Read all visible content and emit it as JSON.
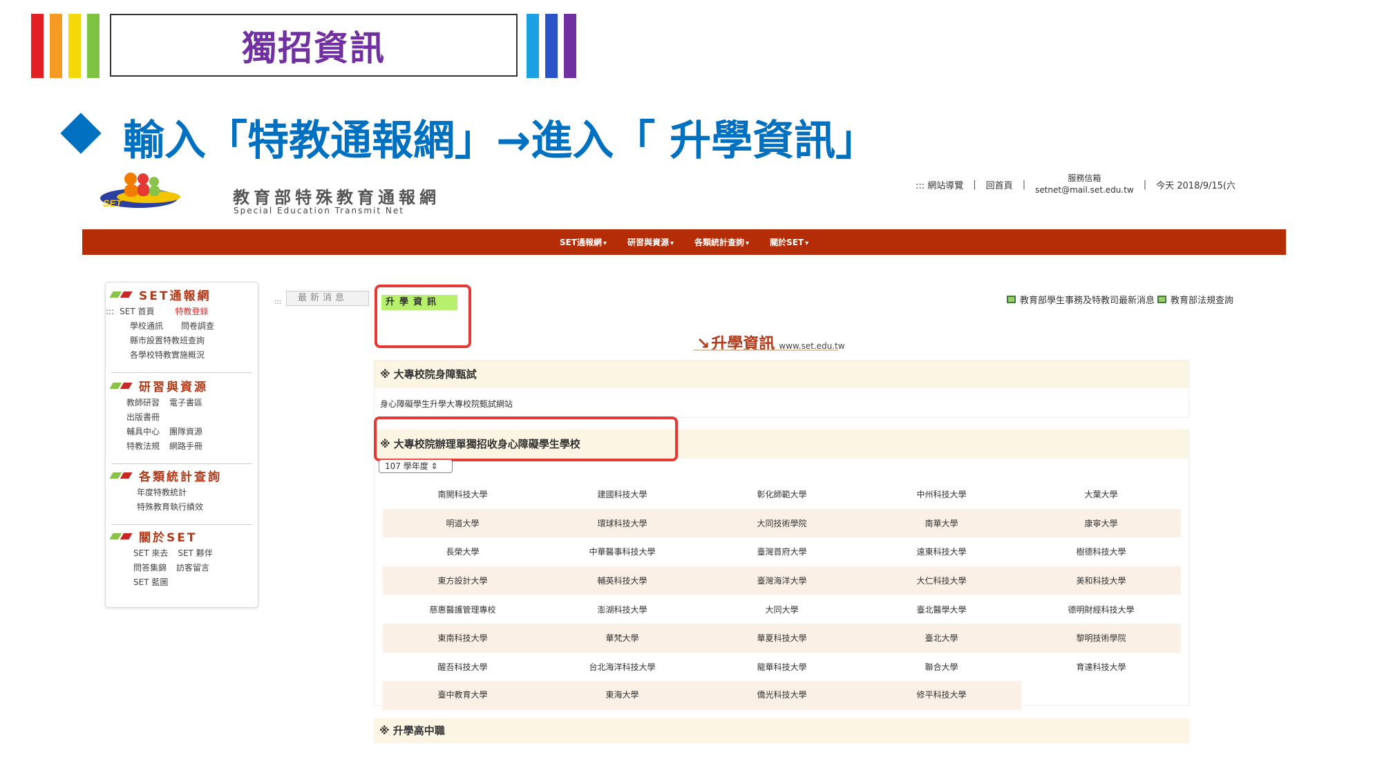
{
  "slide": {
    "title": "獨招資訊",
    "heading": "輸入「特教通報網」→進入「 升學資訊」",
    "bar_colors_left": [
      "#e31e24",
      "#f59a23",
      "#f4d90a",
      "#7dc242"
    ],
    "bar_colors_right": [
      "#1ba1e2",
      "#2a53c6",
      "#7030a0"
    ]
  },
  "site": {
    "logo_text": "SET",
    "title_cn": "教育部特殊教育通報網",
    "title_en": "Special Education Transmit Net",
    "toplinks": {
      "sitemap": "::: 網站導覽",
      "home": "回首頁",
      "mail_label": "服務信箱",
      "mail_address": "setnet@mail.set.edu.tw",
      "date": "今天 2018/9/15(六"
    },
    "nav": [
      "SET通報網",
      "研習與資源",
      "各類統計查詢",
      "關於SET"
    ]
  },
  "sidebar": {
    "sections": [
      {
        "title": "SET通報網",
        "rows": [
          [
            "::: ",
            "SET 首頁",
            "特教登錄"
          ],
          [
            "",
            "學校通訊",
            "問卷調查"
          ],
          [
            "",
            "縣市設置特教班查詢"
          ],
          [
            "",
            "各學校特教實施概況"
          ]
        ]
      },
      {
        "title": "研習與資源",
        "rows": [
          [
            "教師研習",
            "電子書區"
          ],
          [
            "出版書冊"
          ],
          [
            "輔具中心",
            "團隊資源"
          ],
          [
            "特教法規",
            "網路手冊"
          ]
        ]
      },
      {
        "title": "各類統計查詢",
        "rows": [
          [
            "年度特教統計"
          ],
          [
            "特殊教育執行績效"
          ]
        ]
      },
      {
        "title": "關於SET",
        "rows": [
          [
            "SET 來去",
            "SET 夥伴"
          ],
          [
            "問答集錦",
            "訪客留言"
          ],
          [
            "SET 藍圖"
          ]
        ]
      }
    ]
  },
  "content": {
    "tab_news": "最新消息",
    "tab_dots": ":::",
    "tab_active": "升學資訊",
    "right_links": [
      "教育部學生事務及特教司最新消息",
      "教育部法規查詢"
    ],
    "section_title": "升學資訊",
    "section_arrow": "↘",
    "section_url": "www.set.edu.tw",
    "panel1_title": "※ 大專校院身障甄試",
    "panel1_body": "身心障礙學生升學大專校院甄試網站",
    "panel2_title": "※ 大專校院辦理單獨招收身心障礙學生學校",
    "year_select": "107 學年度 ⇕",
    "schools": [
      [
        "南開科技大學",
        "建國科技大學",
        "彰化師範大學",
        "中州科技大學",
        "大葉大學"
      ],
      [
        "明道大學",
        "環球科技大學",
        "大同技術學院",
        "南華大學",
        "康寧大學"
      ],
      [
        "長榮大學",
        "中華醫事科技大學",
        "臺灣首府大學",
        "遠東科技大學",
        "樹德科技大學"
      ],
      [
        "東方設計大學",
        "輔英科技大學",
        "臺灣海洋大學",
        "大仁科技大學",
        "美和科技大學"
      ],
      [
        "慈惠醫護管理專校",
        "澎湖科技大學",
        "大同大學",
        "臺北醫學大學",
        "德明財經科技大學"
      ],
      [
        "東南科技大學",
        "華梵大學",
        "華夏科技大學",
        "臺北大學",
        "黎明技術學院"
      ],
      [
        "醒吾科技大學",
        "台北海洋科技大學",
        "龍華科技大學",
        "聯合大學",
        "育達科技大學"
      ],
      [
        "臺中教育大學",
        "東海大學",
        "僑光科技大學",
        "修平科技大學",
        ""
      ]
    ],
    "panel3_title": "※ 升學高中職"
  }
}
